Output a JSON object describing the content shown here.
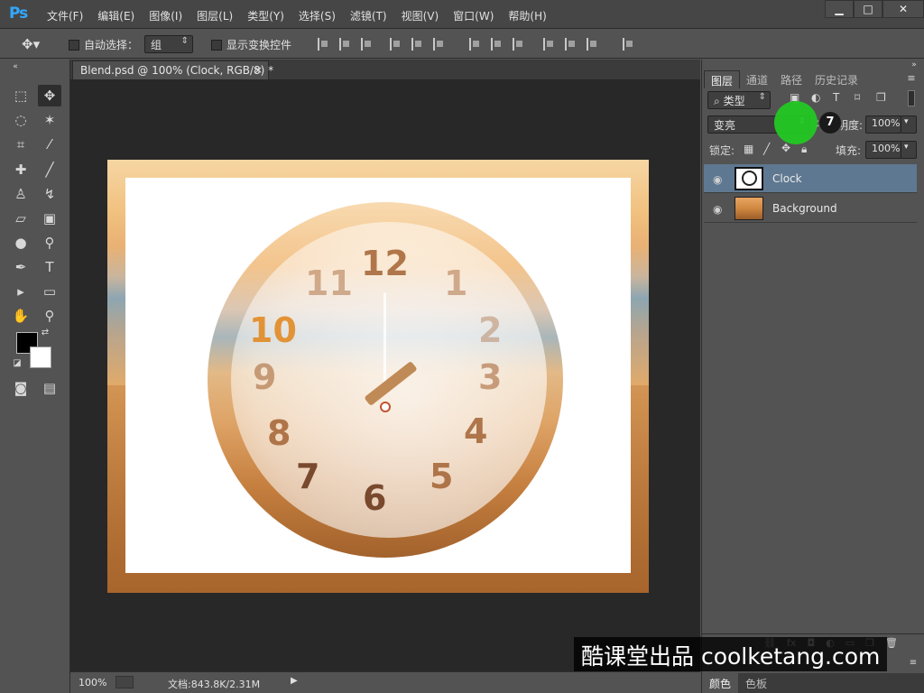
{
  "app": {
    "logo": "Ps"
  },
  "menu": [
    "文件(F)",
    "编辑(E)",
    "图像(I)",
    "图层(L)",
    "类型(Y)",
    "选择(S)",
    "滤镜(T)",
    "视图(V)",
    "窗口(W)",
    "帮助(H)"
  ],
  "window_controls": {
    "minimize": "▁",
    "maximize": "□",
    "close": "✕"
  },
  "options": {
    "auto_select_label": "自动选择：",
    "auto_select_value": "组",
    "show_transform_label": "显示变换控件"
  },
  "document": {
    "tab_title": "Blend.psd @ 100% (Clock, RGB/8) *",
    "tab_close": "×",
    "zoom": "100%",
    "doc_info": "文档:843.8K/2.31M"
  },
  "clock": {
    "numbers": [
      "12",
      "11",
      "1",
      "10",
      "2",
      "9",
      "3",
      "8",
      "4",
      "7",
      "5",
      "6"
    ]
  },
  "layers_panel": {
    "tabs": [
      "图层",
      "通道",
      "路径",
      "历史记录"
    ],
    "filter_label": "类型",
    "blend_mode": "变亮",
    "opacity_label": "不透明度:",
    "opacity_value": "100%",
    "lock_label": "锁定:",
    "fill_label": "填充:",
    "fill_value": "100%",
    "layers": [
      {
        "name": "Clock",
        "selected": true
      },
      {
        "name": "Background",
        "selected": false
      }
    ],
    "footer_icons": [
      "link-icon",
      "fx-icon",
      "mask-icon",
      "adjustment-icon",
      "folder-icon",
      "new-layer-icon",
      "trash-icon"
    ]
  },
  "color_panel": {
    "tabs": [
      "颜色",
      "色板"
    ]
  },
  "cursor_marker": {
    "step": "7"
  },
  "watermark": "酷课堂出品 coolketang.com"
}
